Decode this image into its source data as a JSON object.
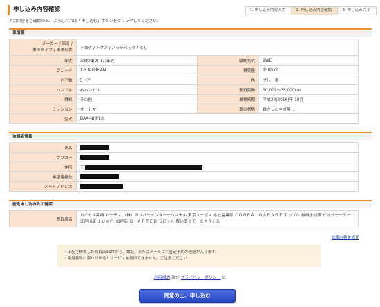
{
  "header": {
    "title": "申し込み内容確認",
    "steps": [
      "1. 申し込み内容入力",
      "2. 申し込み内容確認",
      "3. 申し込み完了"
    ],
    "active_step": 2
  },
  "intro_text": "入力内容をご確認の上、よろしければ「申し込む」ボタンをクリックしてください。",
  "vehicle": {
    "section_title": "車情報",
    "rows": [
      {
        "label": "メーカー / 車名 / 車のタイプ / 車体形状",
        "value": "トヨタ / アクア / ハッチバック / なし"
      }
    ],
    "pairs": [
      {
        "l1": "年式",
        "v1": "平成24(2012)年式",
        "l2": "駆動方式",
        "v2": "2WD"
      },
      {
        "l1": "グレード",
        "v1": "1.5 X-URBAN",
        "l2": "排気量",
        "v2": "1500 cc"
      },
      {
        "l1": "ドア数",
        "v1": "5ドア",
        "l2": "色",
        "v2": "ブルー系"
      },
      {
        "l1": "ハンドル",
        "v1": "右ハンドル",
        "l2": "走行距離",
        "v2": "30,001〜35,000km"
      },
      {
        "l1": "燃料",
        "v1": "その他",
        "l2": "車検時期",
        "v2": "平成28(2016)年 10月"
      },
      {
        "l1": "ミッション",
        "v1": "オートマ",
        "l2": "車の状態",
        "v2": "目立ったキズ無し"
      }
    ],
    "model_label": "型式",
    "model_value": "DAA-NHP10"
  },
  "requester": {
    "section_title": "依頼者情報",
    "rows": [
      {
        "label": "氏名",
        "prefix": ""
      },
      {
        "label": "フリガナ",
        "prefix": ""
      },
      {
        "label": "住所",
        "prefix": "〒"
      },
      {
        "label": "希望連絡先",
        "prefix": ""
      },
      {
        "label": "メールアドレス",
        "prefix": ""
      }
    ]
  },
  "assessment": {
    "section_title": "査定申し込み先の確認",
    "label": "買取店名",
    "value": "バイセル高橋 カーチス （株）ガリバーインターナショナル 東京ユーポス 本社営業部 ＣＯＢＲＡ　ＧＡＲＡＧＥ アップル 板橋志村店 ビッグモーター 江戸川店 ＪＵＭＰ. 松戸店 Ｇ－ＡＦＴＥＲ ラビット 買い取り王　ＣＡＲくる"
  },
  "fix_link": "依頼内容を修正",
  "notice": {
    "lines": [
      "・上記で検索した買取店11件から、電話、またはメールにて査定予約の連絡が入ります。",
      "・電話番号に誤りがあるとサービスを提供できません。ご注意ください"
    ]
  },
  "terms": {
    "terms_link": "利用規約",
    "and_text": " 及び ",
    "privacy_link": "プライバシーポリシー",
    "suffix": " に"
  },
  "submit_label": "同意の上、申し込む",
  "colors": {
    "accent": "#e8912b",
    "label_bg": "#fbe3cf",
    "notice_bg": "#fbf1df",
    "button": "#2c4ccf",
    "link": "#1a3d9c"
  }
}
